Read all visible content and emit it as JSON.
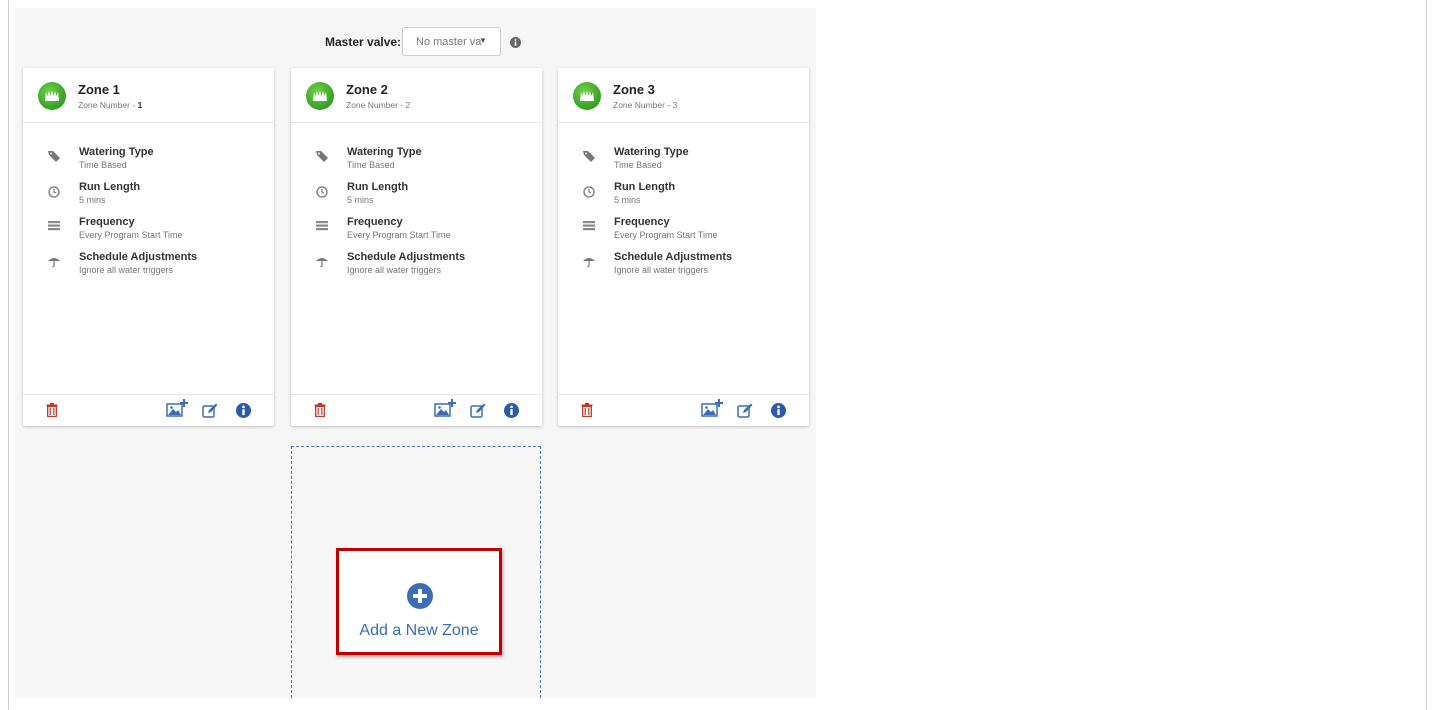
{
  "master_valve": {
    "label": "Master valve:",
    "selected": "No master valve",
    "info_icon": "info-circle-icon"
  },
  "zones": [
    {
      "title": "Zone 1",
      "number_label": "Zone Number - ",
      "number": "1",
      "properties": [
        {
          "icon": "tag-icon",
          "title": "Watering Type",
          "value": "Time Based"
        },
        {
          "icon": "clock-icon",
          "title": "Run Length",
          "value": "5 mins"
        },
        {
          "icon": "frequency-icon",
          "title": "Frequency",
          "value": "Every Program Start Time"
        },
        {
          "icon": "umbrella-icon",
          "title": "Schedule Adjustments",
          "value": "Ignore all water triggers"
        }
      ]
    },
    {
      "title": "Zone 2",
      "number_label": "Zone Number - ",
      "number": "2",
      "properties": [
        {
          "icon": "tag-icon",
          "title": "Watering Type",
          "value": "Time Based"
        },
        {
          "icon": "clock-icon",
          "title": "Run Length",
          "value": "5 mins"
        },
        {
          "icon": "frequency-icon",
          "title": "Frequency",
          "value": "Every Program Start Time"
        },
        {
          "icon": "umbrella-icon",
          "title": "Schedule Adjustments",
          "value": "Ignore all water triggers"
        }
      ]
    },
    {
      "title": "Zone 3",
      "number_label": "Zone Number - ",
      "number": "3",
      "properties": [
        {
          "icon": "tag-icon",
          "title": "Watering Type",
          "value": "Time Based"
        },
        {
          "icon": "clock-icon",
          "title": "Run Length",
          "value": "5 mins"
        },
        {
          "icon": "frequency-icon",
          "title": "Frequency",
          "value": "Every Program Start Time"
        },
        {
          "icon": "umbrella-icon",
          "title": "Schedule Adjustments",
          "value": "Ignore all water triggers"
        }
      ]
    }
  ],
  "card_actions": [
    "delete-icon",
    "add-image-icon",
    "edit-icon",
    "info-icon"
  ],
  "add_zone": {
    "label": "Add a New Zone",
    "icon": "plus-circle-icon"
  },
  "colors": {
    "zone_green": "#3fa82a",
    "delete_red": "#c0392b",
    "action_blue": "#3a6db5",
    "highlight_red": "#c00000",
    "panel_bg": "#f6f6f6"
  }
}
